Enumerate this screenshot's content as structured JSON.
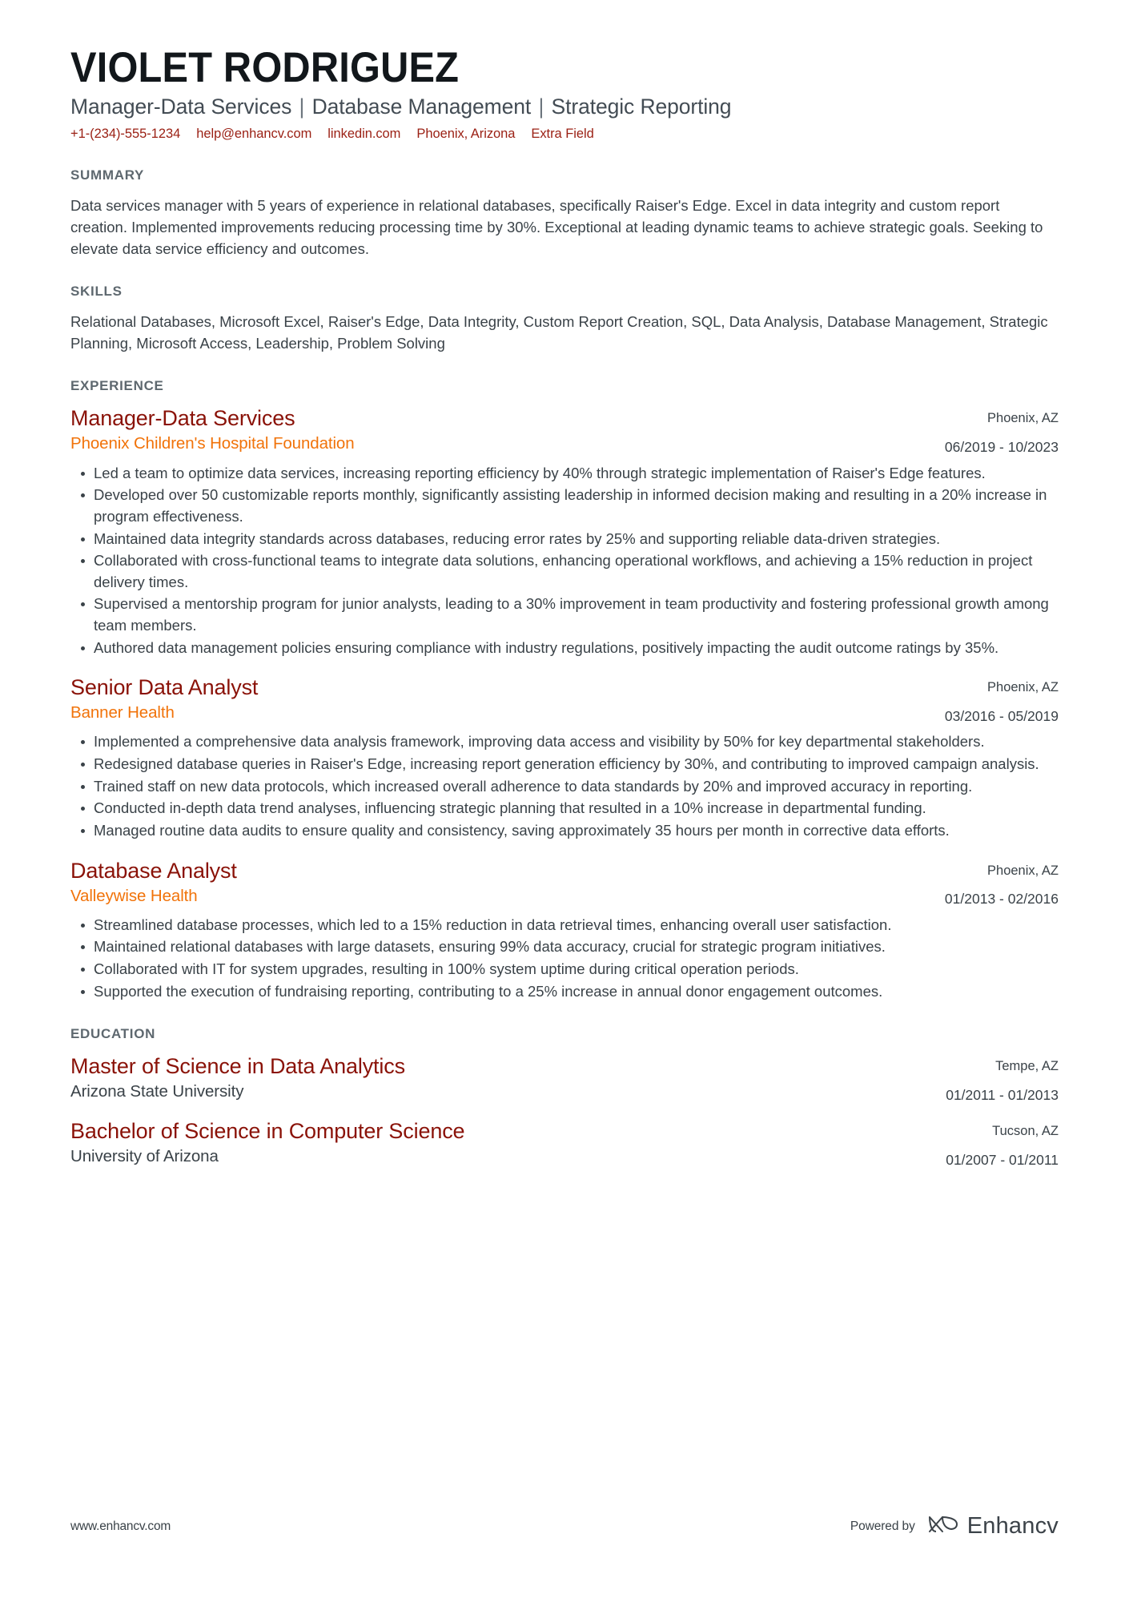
{
  "header": {
    "name": "VIOLET RODRIGUEZ",
    "headline_parts": [
      "Manager-Data Services",
      "Database Management",
      "Strategic Reporting"
    ],
    "separator": "|",
    "contacts": [
      {
        "name": "phone",
        "value": "+1-(234)-555-1234"
      },
      {
        "name": "email",
        "value": "help@enhancv.com"
      },
      {
        "name": "linkedin",
        "value": "linkedin.com"
      },
      {
        "name": "location",
        "value": "Phoenix, Arizona"
      },
      {
        "name": "extra",
        "value": "Extra Field"
      }
    ],
    "accent_color": "#9b2115"
  },
  "summary": {
    "title": "SUMMARY",
    "text": "Data services manager with 5 years of experience in relational databases, specifically Raiser's Edge. Excel in data integrity and custom report creation. Implemented improvements reducing processing time by 30%. Exceptional at leading dynamic teams to achieve strategic goals. Seeking to elevate data service efficiency and outcomes."
  },
  "skills": {
    "title": "SKILLS",
    "text": "Relational Databases, Microsoft Excel, Raiser's Edge, Data Integrity, Custom Report Creation, SQL, Data Analysis, Database Management, Strategic Planning, Microsoft Access, Leadership, Problem Solving"
  },
  "experience": {
    "title": "EXPERIENCE",
    "entries": [
      {
        "title": "Manager-Data Services",
        "organization": "Phoenix Children's Hospital Foundation",
        "location": "Phoenix, AZ",
        "dates": "06/2019 - 10/2023",
        "bullets": [
          "Led a team to optimize data services, increasing reporting efficiency by 40% through strategic implementation of Raiser's Edge features.",
          "Developed over 50 customizable reports monthly, significantly assisting leadership in informed decision making and resulting in a 20% increase in program effectiveness.",
          "Maintained data integrity standards across databases, reducing error rates by 25% and supporting reliable data-driven strategies.",
          "Collaborated with cross-functional teams to integrate data solutions, enhancing operational workflows, and achieving a 15% reduction in project delivery times.",
          "Supervised a mentorship program for junior analysts, leading to a 30% improvement in team productivity and fostering professional growth among team members.",
          "Authored data management policies ensuring compliance with industry regulations, positively impacting the audit outcome ratings by 35%."
        ]
      },
      {
        "title": "Senior Data Analyst",
        "organization": "Banner Health",
        "location": "Phoenix, AZ",
        "dates": "03/2016 - 05/2019",
        "bullets": [
          "Implemented a comprehensive data analysis framework, improving data access and visibility by 50% for key departmental stakeholders.",
          "Redesigned database queries in Raiser's Edge, increasing report generation efficiency by 30%, and contributing to improved campaign analysis.",
          "Trained staff on new data protocols, which increased overall adherence to data standards by 20% and improved accuracy in reporting.",
          "Conducted in-depth data trend analyses, influencing strategic planning that resulted in a 10% increase in departmental funding.",
          "Managed routine data audits to ensure quality and consistency, saving approximately 35 hours per month in corrective data efforts."
        ]
      },
      {
        "title": "Database Analyst",
        "organization": "Valleywise Health",
        "location": "Phoenix, AZ",
        "dates": "01/2013 - 02/2016",
        "bullets": [
          "Streamlined database processes, which led to a 15% reduction in data retrieval times, enhancing overall user satisfaction.",
          "Maintained relational databases with large datasets, ensuring 99% data accuracy, crucial for strategic program initiatives.",
          "Collaborated with IT for system upgrades, resulting in 100% system uptime during critical operation periods.",
          "Supported the execution of fundraising reporting, contributing to a 25% increase in annual donor engagement outcomes."
        ]
      }
    ]
  },
  "education": {
    "title": "EDUCATION",
    "entries": [
      {
        "title": "Master of Science in Data Analytics",
        "organization": "Arizona State University",
        "location": "Tempe, AZ",
        "dates": "01/2011 - 01/2013"
      },
      {
        "title": "Bachelor of Science in Computer Science",
        "organization": "University of Arizona",
        "location": "Tucson, AZ",
        "dates": "01/2007 - 01/2011"
      }
    ]
  },
  "footer": {
    "url": "www.enhancv.com",
    "powered_by": "Powered by",
    "brand": "Enhancv"
  },
  "colors": {
    "title": "#8a1208",
    "organization": "#f1730a",
    "section_title": "#5e686f",
    "body": "#3a4248"
  }
}
